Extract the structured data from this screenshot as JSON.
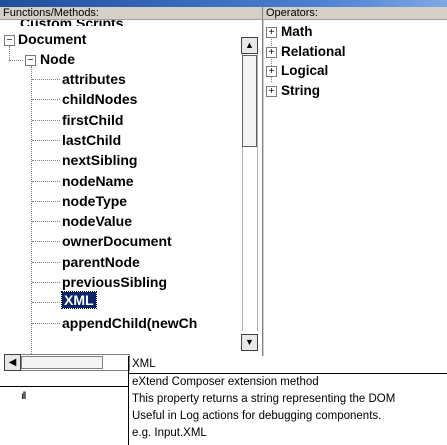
{
  "functions_header": "Functions/Methods:",
  "operators_header": "Operators:",
  "tree": {
    "cut_item": "Custom Scripts",
    "document": "Document",
    "node": "Node",
    "children": [
      "attributes",
      "childNodes",
      "firstChild",
      "lastChild",
      "nextSibling",
      "nodeName",
      "nodeType",
      "nodeValue",
      "ownerDocument",
      "parentNode",
      "previousSibling",
      "XML",
      "appendChild(newCh"
    ],
    "selected": "XML"
  },
  "operators": [
    "Math",
    "Relational",
    "Logical",
    "String"
  ],
  "icons": {
    "collapse": "minus-box-icon",
    "expand": "plus-box-icon",
    "scroll_up": "scroll-up-arrow-icon",
    "scroll_down": "scroll-down-arrow-icon",
    "scroll_left": "scroll-left-arrow-icon"
  },
  "glyphs": {
    "up": "▲",
    "down": "▼",
    "left": "◀",
    "minus": "−",
    "plus": "+"
  },
  "bottom_left_glyph": "ıll",
  "description": {
    "name": "XML",
    "type": "eXtend Composer extension method",
    "text": "This property returns a string representing the DOM",
    "usage": "Useful in Log actions for debugging components.",
    "example": "e.g. Input.XML"
  }
}
